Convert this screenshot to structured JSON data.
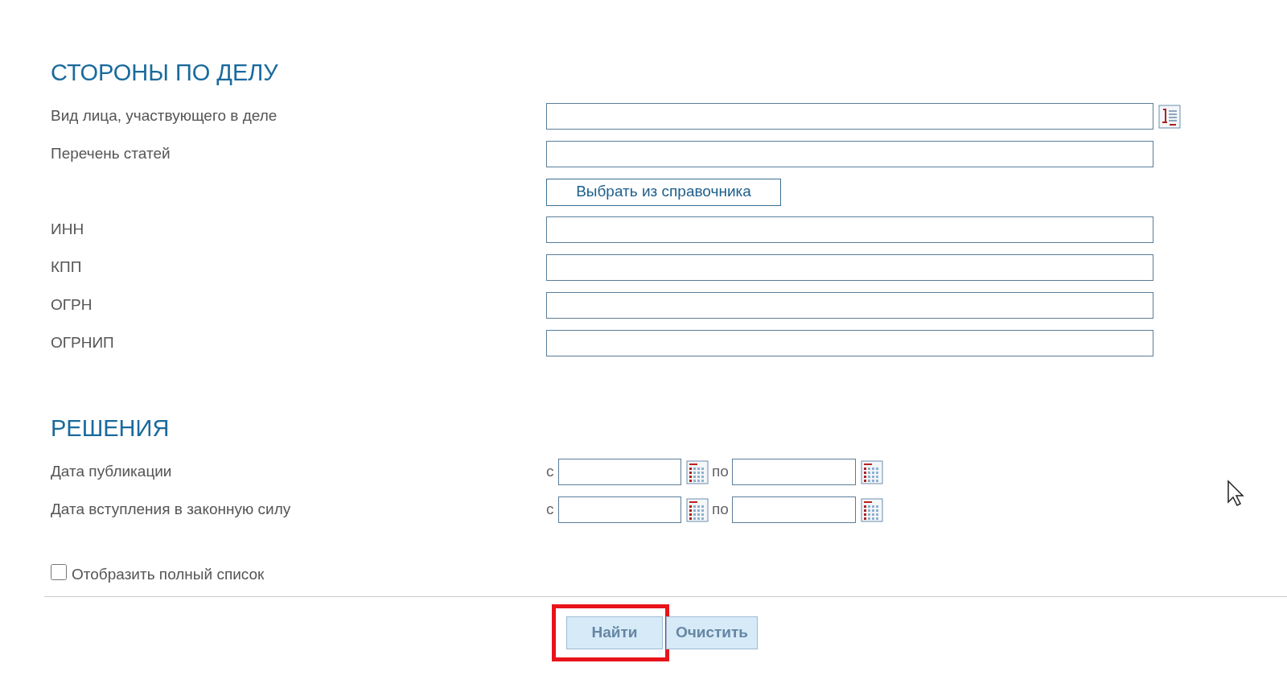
{
  "sections": [
    {
      "title": "СТОРОНЫ ПО ДЕЛУ",
      "rows": [
        {
          "kind": "text",
          "label": "Вид лица, участвующего в деле",
          "lookup": true
        },
        {
          "kind": "text",
          "label": "Перечень статей",
          "lookup": false
        },
        {
          "kind": "button",
          "text": "Выбрать из справочника"
        },
        {
          "kind": "text",
          "label": "ИНН",
          "lookup": false
        },
        {
          "kind": "text",
          "label": "КПП",
          "lookup": false
        },
        {
          "kind": "text",
          "label": "ОГРН",
          "lookup": false
        },
        {
          "kind": "text",
          "label": "ОГРНИП",
          "lookup": false
        }
      ]
    },
    {
      "title": "РЕШЕНИЯ",
      "rows": [
        {
          "kind": "daterange",
          "label": "Дата публикации",
          "from": "с",
          "to": "по"
        },
        {
          "kind": "daterange",
          "label": "Дата вступления в законную силу",
          "from": "с",
          "to": "по"
        }
      ]
    }
  ],
  "full_list": {
    "label": "Отобразить полный список",
    "checked": false
  },
  "actions": [
    {
      "text": "Найти",
      "highlighted": true
    },
    {
      "text": "Очистить",
      "highlighted": false
    }
  ]
}
